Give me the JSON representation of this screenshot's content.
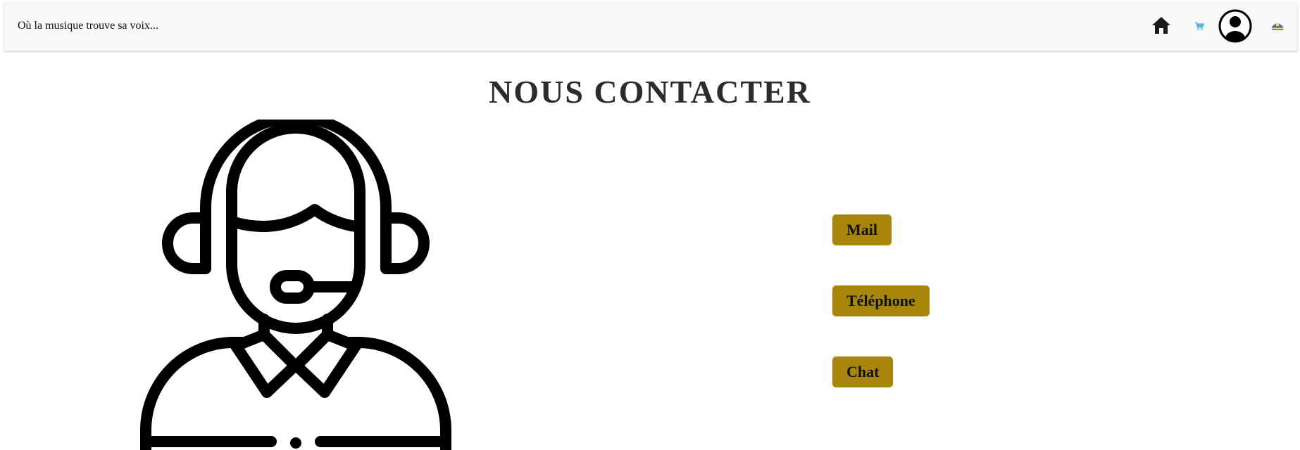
{
  "navbar": {
    "tagline": "Où la musique trouve sa voix...",
    "icons": {
      "home": "home-icon",
      "cart": "cart-icon",
      "profile": "user-profile-icon",
      "language": "language-flag-icon"
    }
  },
  "main": {
    "title": "NOUS CONTACTER",
    "illustration": "customer-support-headset-icon",
    "buttons": {
      "mail": "Mail",
      "phone": "Téléphone",
      "chat": "Chat"
    }
  },
  "colors": {
    "navbar_bg": "#f8f8f8",
    "button_bg": "#a8860a",
    "title": "#2c2c2c",
    "cart_accent": "#5bb8e8"
  }
}
